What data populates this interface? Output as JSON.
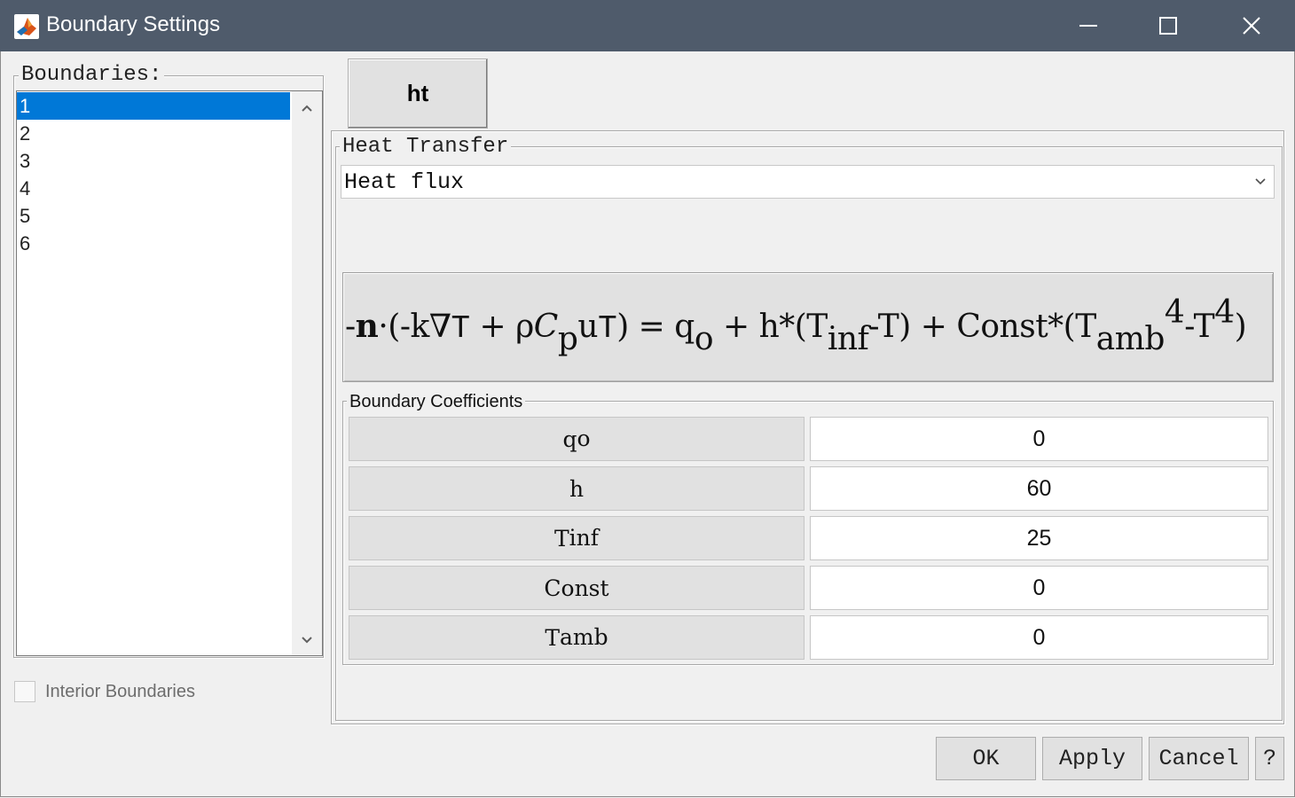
{
  "window": {
    "title": "Boundary Settings"
  },
  "boundaries": {
    "legend": "Boundaries:",
    "items": [
      "1",
      "2",
      "3",
      "4",
      "5",
      "6"
    ],
    "selected": "1",
    "interior_label": "Interior Boundaries"
  },
  "tab": {
    "label": "ht"
  },
  "heat_transfer": {
    "legend": "Heat Transfer",
    "condition": "Heat flux"
  },
  "equation": {
    "text": "-n·(-k∇T + ρCpuT) = qo + h*(Tinf-T) + Const*(Tamb4-T4)"
  },
  "coefficients": {
    "legend": "Boundary Coefficients",
    "rows": [
      {
        "name": "q",
        "sub": "o",
        "value": "0"
      },
      {
        "name": "h",
        "sub": "",
        "value": "60"
      },
      {
        "name": "T",
        "sub": "inf",
        "value": "25"
      },
      {
        "name": "Const",
        "sub": "",
        "value": "0"
      },
      {
        "name": "T",
        "sub": "amb",
        "value": "0"
      }
    ]
  },
  "buttons": {
    "ok": "OK",
    "apply": "Apply",
    "cancel": "Cancel",
    "help": "?"
  },
  "colors": {
    "titlebar": "#4f5b6b",
    "selection": "#0078d7",
    "button_face": "#e1e1e1"
  }
}
